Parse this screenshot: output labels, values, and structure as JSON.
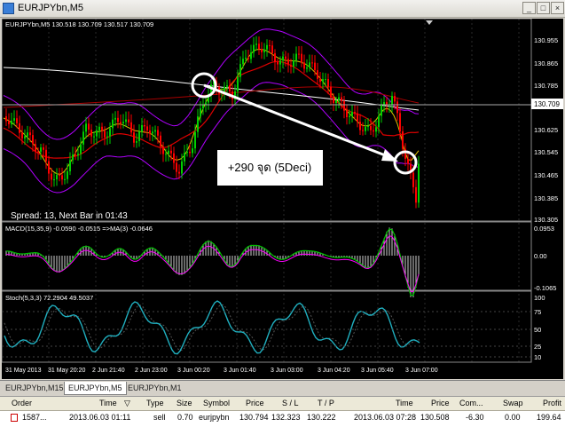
{
  "window": {
    "title": "EURJPYbn,M5"
  },
  "chart": {
    "info": "EURJPYbn,M5  130.518 130.709 130.517 130.709",
    "status": "Spread: 13, Next Bar in 01:43",
    "annotation": "+290 จุด (5Deci)",
    "price_labels": [
      "130.955",
      "130.865",
      "130.785",
      "130.709",
      "130.625",
      "130.545",
      "130.465",
      "130.385",
      "130.305"
    ],
    "current_price": "130.709",
    "macd_label": "MACD(15,35,9) -0.0590 -0.0515 =>MA(3) -0.0646",
    "macd_scale": [
      "0.0953",
      "0.00",
      "-0.1065"
    ],
    "stoch_label": "Stoch(5,3,3) 72.2904 49.5037",
    "stoch_scale": [
      "100",
      "75",
      "50",
      "25",
      "10"
    ],
    "time_labels": [
      "31 May 2013",
      "31 May 20:20",
      "2 Jun 21:40",
      "2 Jun 23:00",
      "3 Jun 00:20",
      "3 Jun 01:40",
      "3 Jun 03:00",
      "3 Jun 04:20",
      "3 Jun 05:40",
      "3 Jun 07:00"
    ],
    "colors": {
      "up": "#00d000",
      "down": "#ff0000",
      "bands": "#b000ff",
      "ma_slow": "#ffffff",
      "ma_mid": "#dd0000",
      "ma_fast": "#e0c000",
      "macd": "#00c000",
      "macd_signal": "#ff00ff",
      "stoch": "#20b0c0"
    }
  },
  "tabs": [
    "EURJPYbn,M15",
    "EURJPYbn,M5",
    "EURJPYbn,M1"
  ],
  "orders": {
    "headers": [
      "Order",
      "Time",
      "Type",
      "Size",
      "Symbol",
      "Price",
      "S / L",
      "T / P",
      "Time",
      "Price",
      "Com...",
      "Swap",
      "Profit"
    ],
    "rows": [
      [
        "1587...",
        "2013.06.03 01:11",
        "sell",
        "0.70",
        "eurjpybn",
        "130.794",
        "132.323",
        "130.222",
        "2013.06.03 07:28",
        "130.508",
        "-6.30",
        "0.00",
        "199.64"
      ]
    ]
  }
}
